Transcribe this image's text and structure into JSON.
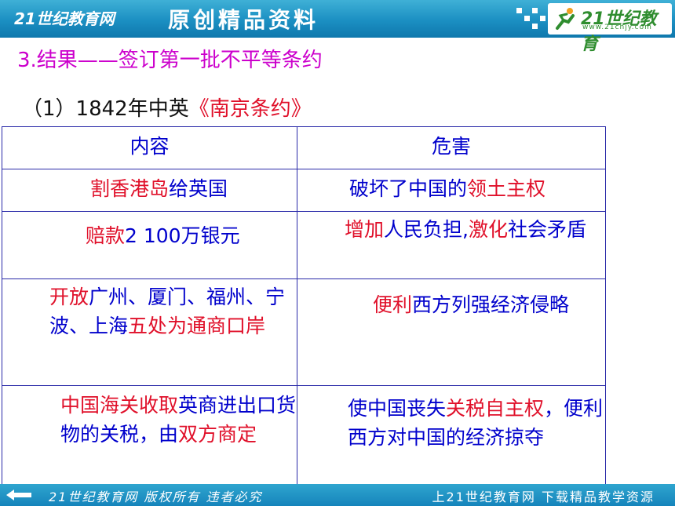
{
  "banner": {
    "site_name": "21世纪教育网",
    "slogan": "原创精品资料",
    "logo_text": "21世纪教育",
    "logo_url": "www.21cnjy.com"
  },
  "heading": "3.结果——签订第一批不平等条约",
  "subheading": {
    "prefix": "（1）1842年中英",
    "treaty": "《南京条约》"
  },
  "table": {
    "headers": [
      "内容",
      "危害"
    ],
    "rows": [
      {
        "content": [
          {
            "text": "割香港岛",
            "hl": true
          },
          {
            "text": "给英国",
            "hl": false
          }
        ],
        "harm": [
          {
            "text": "破坏了中国的",
            "hl": false
          },
          {
            "text": "领土主权",
            "hl": true
          }
        ]
      },
      {
        "content": [
          {
            "text": "赔款",
            "hl": true
          },
          {
            "text": "2  100万银元",
            "hl": false
          }
        ],
        "harm": [
          {
            "text": "增加",
            "hl": true
          },
          {
            "text": "人民负担,",
            "hl": false
          },
          {
            "text": "激化",
            "hl": true
          },
          {
            "text": "社会矛盾",
            "hl": false
          }
        ]
      },
      {
        "content": [
          {
            "text": "开放",
            "hl": true
          },
          {
            "text": "广州、厦门、福州、宁波、上海",
            "hl": false
          },
          {
            "text": "五处为通商口岸",
            "hl": true
          }
        ],
        "harm": [
          {
            "text": "便利",
            "hl": true
          },
          {
            "text": "西方列强经济侵略",
            "hl": false
          }
        ]
      },
      {
        "content": [
          {
            "text": "中国海关收取",
            "hl": true
          },
          {
            "text": "英商进出口货物的关税，由",
            "hl": false
          },
          {
            "text": "双方商定",
            "hl": true
          }
        ],
        "harm": [
          {
            "text": "使中国丧失",
            "hl": false
          },
          {
            "text": "关税自主权",
            "hl": true
          },
          {
            "text": "，便利西方对中国的经济掠夺",
            "hl": false
          }
        ]
      }
    ]
  },
  "footer": {
    "copyright": "21世纪教育网 版权所有 违者必究",
    "promo": "上21世纪教育网 下载精品教学资源"
  },
  "colors": {
    "banner_blue": "#1b8fc2",
    "heading_magenta": "#cc00cc",
    "highlight_red": "#e0102a",
    "body_blue": "#0000cc"
  }
}
